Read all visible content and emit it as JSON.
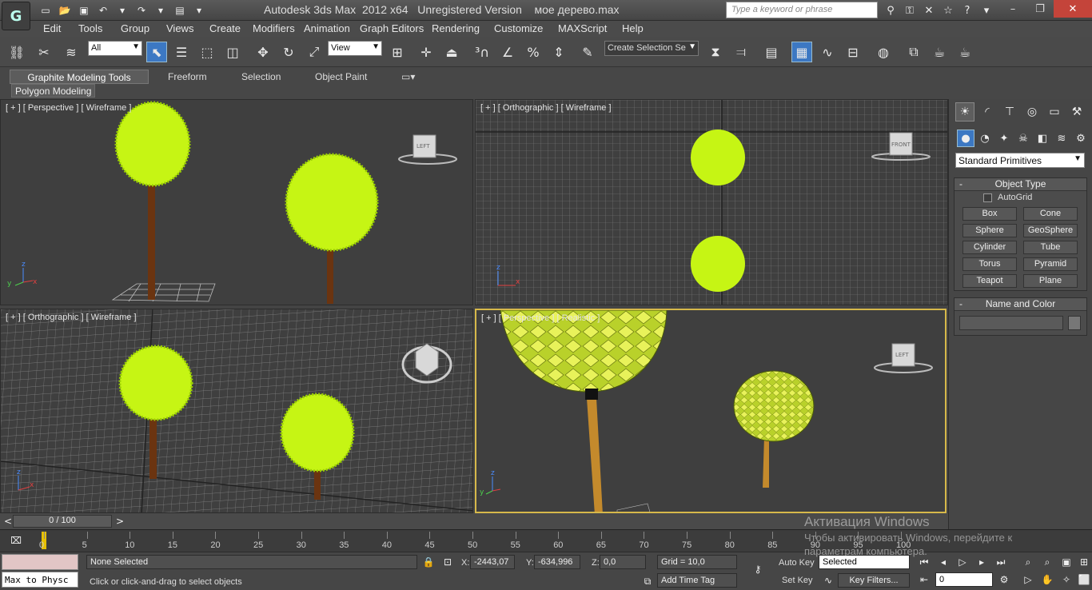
{
  "title_bar": {
    "app_logo_icon": "3ds-max-logo",
    "title": "Autodesk 3ds Max  2012 x64   Unregistered Version    мое дерево.max",
    "search_placeholder": "Type a keyword or phrase"
  },
  "menu": [
    "Edit",
    "Tools",
    "Group",
    "Views",
    "Create",
    "Modifiers",
    "Animation",
    "Graph Editors",
    "Rendering",
    "Customize",
    "MAXScript",
    "Help"
  ],
  "toolbar": {
    "filter_value": "All",
    "refcoord_value": "View",
    "selection_set_value": "Create Selection Se"
  },
  "ribbon": {
    "tabs": [
      "Graphite Modeling Tools",
      "Freeform",
      "Selection",
      "Object Paint"
    ],
    "panel_label": "Polygon Modeling"
  },
  "viewports": {
    "top_left": "[ + ] [ Perspective ] [ Wireframe ]",
    "top_right": "[ + ] [ Orthographic ] [ Wireframe ]",
    "bottom_left": "[ + ] [ Orthographic ] [ Wireframe ]",
    "bottom_right": "[ + ] [ Perspective ] [ Realistic ]"
  },
  "command_panel": {
    "category_dropdown": "Standard Primitives",
    "object_type_title": "Object Type",
    "autogrid_label": "AutoGrid",
    "object_buttons": [
      "Box",
      "Cone",
      "Sphere",
      "GeoSphere",
      "Cylinder",
      "Tube",
      "Torus",
      "Pyramid",
      "Teapot",
      "Plane"
    ],
    "name_color_title": "Name and Color"
  },
  "timeline": {
    "frame_counter": "0 / 100",
    "ticks": [
      "0",
      "5",
      "10",
      "15",
      "20",
      "25",
      "30",
      "35",
      "40",
      "45",
      "50",
      "55",
      "60",
      "65",
      "70",
      "75",
      "80",
      "85",
      "90",
      "95",
      "100"
    ]
  },
  "status_bar": {
    "maxscript_text": "Max to Physc",
    "selection_status": "None Selected",
    "prompt": "Click or click-and-drag to select objects",
    "x_label": "X:",
    "x_value": "-2443,07",
    "y_label": "Y:",
    "y_value": "-634,996",
    "z_label": "Z:",
    "z_value": "0,0",
    "grid": "Grid = 10,0",
    "add_time_tag": "Add Time Tag",
    "auto_key": "Auto Key",
    "set_key": "Set Key",
    "selected_dropdown": "Selected",
    "key_filters": "Key Filters...",
    "frame_value": "0"
  },
  "watermark": {
    "title": "Активация Windows",
    "subtitle": "Чтобы активировать Windows, перейдите к",
    "subtitle2": "параметрам компьютера."
  },
  "colors": {
    "foliage": "#c6f514",
    "trunk": "#6b3410",
    "viewport_bg": "#3f3f3f",
    "active_border": "#d6b84a"
  }
}
